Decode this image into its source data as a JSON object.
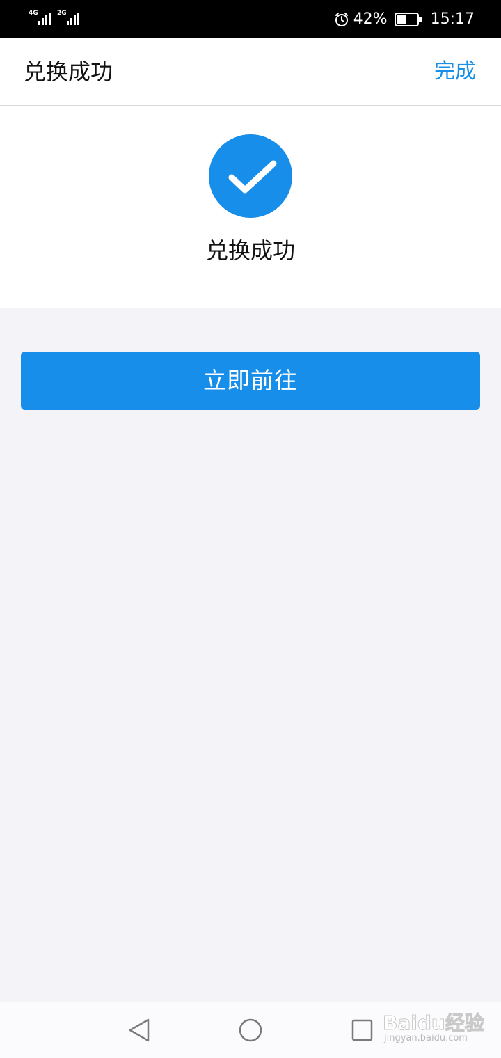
{
  "status_bar": {
    "sim1_network": "4G",
    "sim2_network": "2G",
    "battery": "42%",
    "time": "15:17",
    "icons": [
      "signal-icon",
      "alarm-icon",
      "battery-icon"
    ]
  },
  "header": {
    "title": "兑换成功",
    "done_label": "完成"
  },
  "result": {
    "message": "兑换成功",
    "icon": "check-circle-icon"
  },
  "actions": {
    "go_label": "立即前往"
  },
  "nav": {
    "icons": [
      "back-icon",
      "home-icon",
      "recent-apps-icon"
    ]
  },
  "watermark": {
    "brand": "Baidu经验",
    "url": "jingyan.baidu.com"
  },
  "colors": {
    "accent": "#178eea",
    "link": "#1a8fe6",
    "background": "#f4f4f8"
  }
}
